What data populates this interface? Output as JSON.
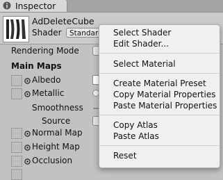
{
  "window": {
    "tab_label": "Inspector"
  },
  "header": {
    "asset_name": "AdDeleteCube",
    "shader_label": "Shader",
    "shader_value": "Standard"
  },
  "body": {
    "rendering_mode_label": "Rendering Mode",
    "main_maps_label": "Main Maps",
    "albedo_label": "Albedo",
    "metallic_label": "Metallic",
    "smoothness_label": "Smoothness",
    "source_label": "Source",
    "normal_map_label": "Normal Map",
    "height_map_label": "Height Map",
    "occlusion_label": "Occlusion"
  },
  "menu": {
    "items": [
      "Select Shader",
      "Edit Shader...",
      "Select Material",
      "Create Material Preset",
      "Copy Material Properties",
      "Paste Material Properties",
      "Copy Atlas",
      "Paste Atlas",
      "Reset"
    ]
  }
}
